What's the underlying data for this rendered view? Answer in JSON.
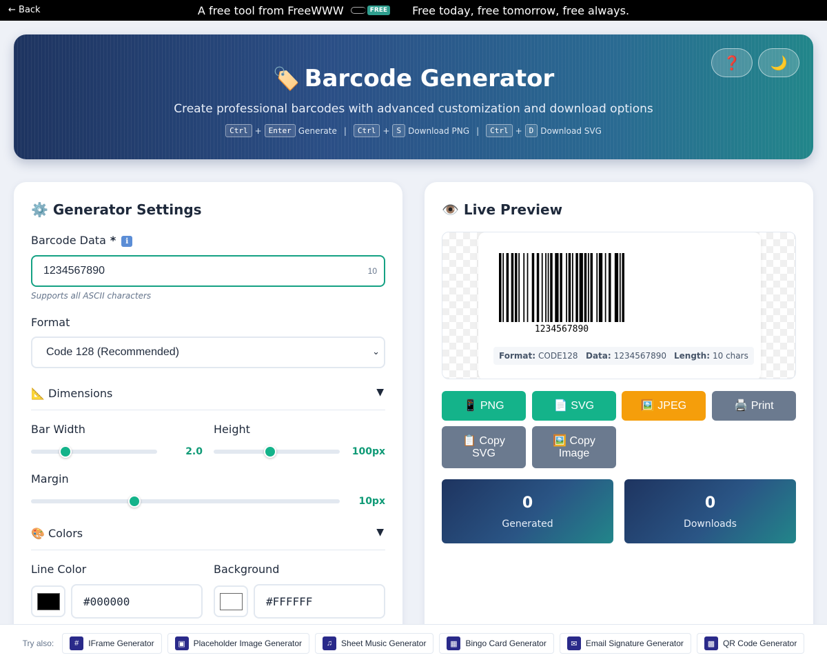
{
  "topbar": {
    "back_label": "← Back",
    "left_text": "A free tool from FreeWWW",
    "badge_text": "FREE",
    "right_text": "Free today, free tomorrow, free always."
  },
  "hero": {
    "icon": "🏷️",
    "title": "Barcode Generator",
    "subtitle": "Create professional barcodes with advanced customization and download options",
    "shortcuts": [
      {
        "key1": "Ctrl",
        "plus": "+",
        "key2": "Enter",
        "label": "Generate"
      },
      {
        "key1": "Ctrl",
        "plus": "+",
        "key2": "S",
        "label": "Download PNG"
      },
      {
        "key1": "Ctrl",
        "plus": "+",
        "key2": "D",
        "label": "Download SVG"
      }
    ],
    "separator": "|",
    "help_icon": "❓",
    "theme_icon": "🌙"
  },
  "settings": {
    "title": "⚙️ Generator Settings",
    "data_label": "Barcode Data",
    "required_mark": "*",
    "info_icon": "ℹ",
    "data_value": "1234567890",
    "char_count": "10",
    "hint": "Supports all ASCII characters",
    "format_label": "Format",
    "format_value": "Code 128 (Recommended)",
    "format_chevron": "⌄",
    "dimensions_title": "📐 Dimensions",
    "section_arrow": "▼",
    "bar_width_label": "Bar Width",
    "bar_width_value": "2.0",
    "bar_width_fraction": 0.275,
    "height_label": "Height",
    "height_value": "100px",
    "height_fraction": 0.45,
    "margin_label": "Margin",
    "margin_value": "10px",
    "margin_fraction": 0.335,
    "colors_title": "🎨 Colors",
    "line_color_label": "Line Color",
    "line_color_value": "#000000",
    "background_label": "Background",
    "background_value": "#FFFFFF"
  },
  "preview": {
    "title": "👁️ Live Preview",
    "barcode_text": "1234567890",
    "format_key": "Format:",
    "format_val": "CODE128",
    "data_key": "Data:",
    "data_val": "1234567890",
    "length_key": "Length:",
    "length_val": "10 chars",
    "buttons": {
      "png": "📱 PNG",
      "svg": "📄 SVG",
      "jpeg": "🖼️ JPEG",
      "print": "🖨️ Print",
      "copy_svg": "📋 Copy SVG",
      "copy_image": "🖼️ Copy Image"
    },
    "stats": {
      "generated_value": "0",
      "generated_label": "Generated",
      "downloads_value": "0",
      "downloads_label": "Downloads"
    }
  },
  "footer": {
    "try_label": "Try also:",
    "links": [
      {
        "icon": "#",
        "label": "IFrame Generator"
      },
      {
        "icon": "▣",
        "label": "Placeholder Image Generator"
      },
      {
        "icon": "♫",
        "label": "Sheet Music Generator"
      },
      {
        "icon": "▦",
        "label": "Bingo Card Generator"
      },
      {
        "icon": "✉",
        "label": "Email Signature Generator"
      },
      {
        "icon": "▩",
        "label": "QR Code Generator"
      }
    ]
  },
  "colors": {
    "accent": "#14b38a",
    "primary_dark": "#1e3460",
    "orange": "#f59e0b",
    "gray_button": "#6b7a8f"
  }
}
